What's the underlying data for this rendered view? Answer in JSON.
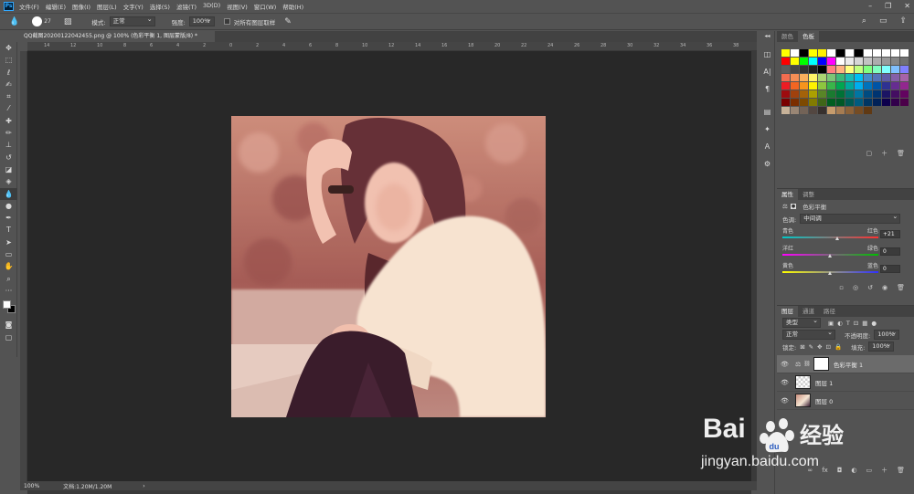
{
  "menubar": {
    "items": [
      "文件(F)",
      "编辑(E)",
      "图像(I)",
      "图层(L)",
      "文字(Y)",
      "选择(S)",
      "滤镜(T)",
      "3D(D)",
      "视图(V)",
      "窗口(W)",
      "帮助(H)"
    ],
    "logo": "Ps"
  },
  "options": {
    "brush_size": "27",
    "mode_label": "模式:",
    "mode_value": "正常",
    "strength_label": "强度:",
    "strength_value": "100%",
    "sample_all_label": "对所有图层取样"
  },
  "document": {
    "tab_title": "QQ截图20200122042455.png @ 100% (色彩平衡 1, 图层蒙版/8) *"
  },
  "ruler": {
    "top_labels": [
      "14",
      "12",
      "10",
      "8",
      "6",
      "4",
      "2",
      "0",
      "2",
      "4",
      "6",
      "8",
      "10",
      "12",
      "14",
      "16",
      "18",
      "20",
      "22",
      "24",
      "26",
      "28",
      "30",
      "32",
      "34",
      "36",
      "38"
    ]
  },
  "status": {
    "zoom": "100%",
    "doc_info": "文档:1.20M/1.20M"
  },
  "swatches_panel": {
    "tabs": [
      "颜色",
      "色板"
    ],
    "active_tab": "色板",
    "colors": [
      "#ffff00",
      "#ffffff",
      "#000000",
      "#ffff00",
      "#fff200",
      "#ffffff",
      "#000000",
      "#ffffff",
      "#000000",
      "#ffffff",
      "#ffffff",
      "#ffffff",
      "#ffffff",
      "#ffffff",
      "#ff0000",
      "#ffff00",
      "#00ff00",
      "#00ffff",
      "#0000ff",
      "#ff00ff",
      "#ffffff",
      "#ebebeb",
      "#d6d6d6",
      "#c2c2c2",
      "#adadad",
      "#999999",
      "#858585",
      "#707070",
      "#5c5c5c",
      "#474747",
      "#333333",
      "#1f1f1f",
      "#000000",
      "#ff8080",
      "#ffb380",
      "#ffff80",
      "#c0ff80",
      "#80ff80",
      "#80ffc0",
      "#80ffff",
      "#80c0ff",
      "#8080ff",
      "#f26c4f",
      "#f68e55",
      "#fbaf5c",
      "#fff467",
      "#acd372",
      "#7cc576",
      "#3bb878",
      "#1abbb4",
      "#00bff3",
      "#438ccb",
      "#5574b9",
      "#605ca8",
      "#855fa8",
      "#a763a8",
      "#ed1c24",
      "#f26522",
      "#f7941d",
      "#fff200",
      "#8dc63f",
      "#39b54a",
      "#00a651",
      "#00a99d",
      "#00aeef",
      "#0072bc",
      "#0054a6",
      "#2e3192",
      "#662d91",
      "#92278f",
      "#9e0b0f",
      "#a0410d",
      "#a36209",
      "#aba000",
      "#598527",
      "#1a7b30",
      "#007236",
      "#00746b",
      "#0076a3",
      "#004b80",
      "#003471",
      "#1b1464",
      "#440e62",
      "#630460",
      "#790000",
      "#7b2e00",
      "#7d4900",
      "#827b00",
      "#406618",
      "#005e20",
      "#005826",
      "#005952",
      "#005b7f",
      "#003663",
      "#002157",
      "#0d004c",
      "#32004b",
      "#4b0049",
      "#c7b299",
      "#998675",
      "#736357",
      "#534741",
      "#37302d",
      "#c69c6d",
      "#a67c52",
      "#8c6239",
      "#754c24",
      "#603913"
    ]
  },
  "properties_panel": {
    "tabs": [
      "属性",
      "调整"
    ],
    "active_tab": "属性",
    "adjustment_name": "色彩平衡",
    "tone_label": "色调:",
    "tone_value": "中间调",
    "sliders": [
      {
        "left": "青色",
        "right": "红色",
        "value": "+21",
        "position": 0.58,
        "colors": [
          "#00c8c8",
          "#ff3030"
        ]
      },
      {
        "left": "洋红",
        "right": "绿色",
        "value": "0",
        "position": 0.5,
        "colors": [
          "#ff00ff",
          "#00c000"
        ]
      },
      {
        "left": "黄色",
        "right": "蓝色",
        "value": "0",
        "position": 0.5,
        "colors": [
          "#ffff00",
          "#3030ff"
        ]
      }
    ]
  },
  "layers_panel": {
    "tabs": [
      "图层",
      "通道",
      "路径"
    ],
    "active_tab": "图层",
    "filter_label": "类型",
    "blend_mode": "正常",
    "opacity_label": "不透明度:",
    "opacity_value": "100%",
    "lock_label": "锁定:",
    "fill_label": "填充:",
    "fill_value": "100%",
    "layers": [
      {
        "name": "色彩平衡 1",
        "type": "adjustment",
        "selected": true
      },
      {
        "name": "图层 1",
        "type": "transparent",
        "selected": false
      },
      {
        "name": "图层 0",
        "type": "photo",
        "selected": false
      }
    ]
  },
  "watermark": {
    "brand_left": "Bai",
    "brand_right": "经验",
    "url": "jingyan.baidu.com"
  }
}
